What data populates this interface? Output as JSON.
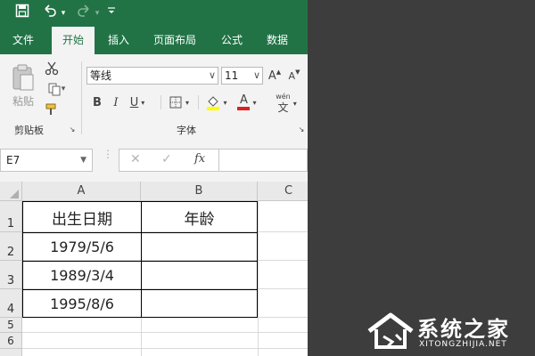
{
  "titlebar": {
    "save_icon": "save-icon",
    "undo_icon": "undo-icon",
    "redo_icon": "redo-icon",
    "customize_icon": "customize-quick-access-icon"
  },
  "tabs": [
    {
      "label": "文件",
      "active": false
    },
    {
      "label": "开始",
      "active": true
    },
    {
      "label": "插入",
      "active": false
    },
    {
      "label": "页面布局",
      "active": false
    },
    {
      "label": "公式",
      "active": false
    },
    {
      "label": "数据",
      "active": false
    }
  ],
  "ribbon": {
    "paste_label": "粘贴",
    "clipboard_group": "剪贴板",
    "font_group": "字体",
    "font_name": "等线",
    "font_size": "11",
    "bold": "B",
    "italic": "I",
    "underline": "U",
    "font_color_letter": "A",
    "grow_letter": "A",
    "shrink_letter": "A",
    "phonetic_top": "wén",
    "phonetic_bottom": "文"
  },
  "formula_bar": {
    "name_box": "E7",
    "fx_label": "fx",
    "formula": ""
  },
  "columns": [
    "A",
    "B",
    "C"
  ],
  "rows": [
    "1",
    "2",
    "3",
    "4",
    "5",
    "6"
  ],
  "table": {
    "header": [
      "出生日期",
      "年龄"
    ],
    "rows": [
      [
        "1979/5/6",
        ""
      ],
      [
        "1989/3/4",
        ""
      ],
      [
        "1995/8/6",
        ""
      ]
    ]
  },
  "watermark": {
    "title": "系统之家",
    "url": "XITONGZHIJIA.NET"
  },
  "colors": {
    "brand": "#217346",
    "background_dark": "#3d3d3d"
  }
}
